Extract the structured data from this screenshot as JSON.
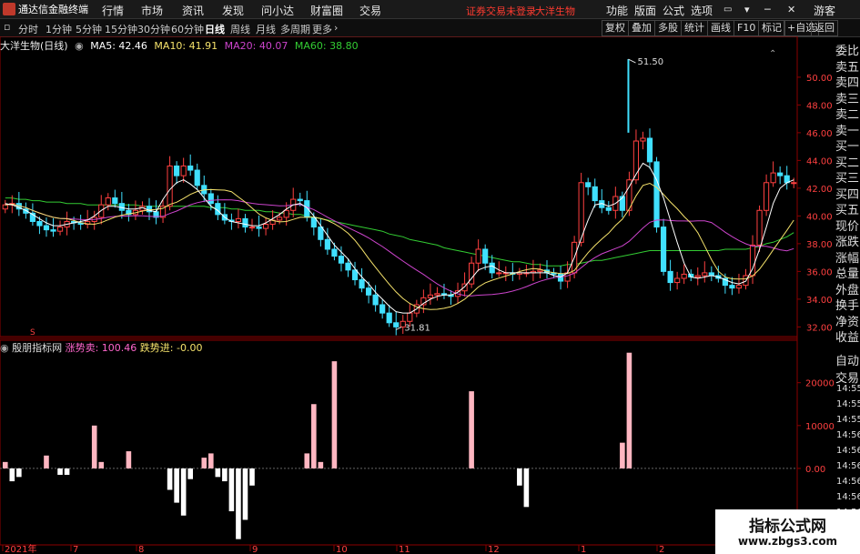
{
  "app": {
    "title": "通达信金融终端",
    "menus": [
      "行情",
      "市场",
      "资讯",
      "发现",
      "问小达",
      "财富圈",
      "交易"
    ],
    "notice": "证券交易未登录",
    "stock_name": "大洋生物",
    "right_menus": [
      "功能",
      "版面",
      "公式",
      "选项"
    ],
    "user": "游客"
  },
  "toolbar": {
    "periods": [
      "分时",
      "1分钟",
      "5分钟",
      "15分钟",
      "30分钟",
      "60分钟",
      "日线",
      "周线",
      "月线",
      "多周期",
      "更多"
    ],
    "active_period": "日线",
    "right_buttons": [
      "复权",
      "叠加",
      "多股",
      "统计",
      "画线",
      "F10",
      "标记",
      "+自选",
      "返回"
    ]
  },
  "main_chart": {
    "title": "大洋生物(日线)",
    "ma": [
      {
        "label": "MA5: 42.46",
        "color": "#ffffff"
      },
      {
        "label": "MA10: 41.91",
        "color": "#f5e26b"
      },
      {
        "label": "MA20: 40.07",
        "color": "#cc44cc"
      },
      {
        "label": "MA60: 38.80",
        "color": "#33cc33"
      }
    ],
    "high_label": "51.50",
    "low_label": "31.81",
    "y_ticks": [
      "50.00",
      "48.00",
      "46.00",
      "44.00",
      "42.00",
      "40.00",
      "38.00",
      "36.00",
      "34.00",
      "32.00"
    ]
  },
  "side_panel": [
    "委比",
    "卖五",
    "卖四",
    "卖三",
    "卖二",
    "卖一",
    "买一",
    "买二",
    "买三",
    "买四",
    "买五",
    "现价",
    "涨跌",
    "涨幅",
    "总量",
    "外盘",
    "换手",
    "净资",
    "收益"
  ],
  "indicator": {
    "name": "殷朋指标网",
    "sell_label": "涨势卖: 100.46",
    "buy_label": "跌势进: -0.00",
    "y_ticks": [
      "20000",
      "10000",
      "0.00"
    ],
    "auto_trade": [
      "自动",
      "交易"
    ]
  },
  "time_list": [
    "14:55",
    "14:55",
    "14:55",
    "14:56",
    "14:56",
    "14:56",
    "14:56",
    "14:56",
    "14:56",
    "14:56",
    "14:56"
  ],
  "x_axis": [
    "2021年",
    "7",
    "8",
    "9",
    "10",
    "11",
    "12",
    "1",
    "2"
  ],
  "watermark": {
    "line1": "指标公式网",
    "line2": "www.zbgs3.com"
  },
  "colors": {
    "up": "#ff4040",
    "down": "#40e0ff",
    "ma5": "#ffffff",
    "ma10": "#f5e26b",
    "ma20": "#cc44cc",
    "ma60": "#33cc33",
    "sell": "#ffb6c1",
    "buy": "#ffffff"
  },
  "chart_data": {
    "type": "candlestick",
    "price_ylim": [
      31.5,
      51.5
    ],
    "indicator_ylim": [
      -17000,
      28000
    ],
    "price_series": [
      40.8,
      40.9,
      40.5,
      40.2,
      39.6,
      39.3,
      39.0,
      38.9,
      39.2,
      39.6,
      39.5,
      39.4,
      39.6,
      39.9,
      40.8,
      41.3,
      40.9,
      40.4,
      40.1,
      40.4,
      40.7,
      40.3,
      39.9,
      40.7,
      43.6,
      42.9,
      43.6,
      43.3,
      42.2,
      41.6,
      40.9,
      40.1,
      39.7,
      39.6,
      39.8,
      39.2,
      39.2,
      39.1,
      39.4,
      39.7,
      39.9,
      40.4,
      41.2,
      41.1,
      39.9,
      39.2,
      38.3,
      37.6,
      37.1,
      36.6,
      36.1,
      35.4,
      34.8,
      34.3,
      33.6,
      33.0,
      32.3,
      32.0,
      32.4,
      33.0,
      33.6,
      34.1,
      34.3,
      34.4,
      34.3,
      34.2,
      34.6,
      35.1,
      36.6,
      37.6,
      36.6,
      35.9,
      35.9,
      35.9,
      35.8,
      35.9,
      35.9,
      36.0,
      36.1,
      35.9,
      35.8,
      35.3,
      35.9,
      38.1,
      42.4,
      42.1,
      41.1,
      40.6,
      40.4,
      41.4,
      40.4,
      42.6,
      45.4,
      45.6,
      43.9,
      39.2,
      36.0,
      35.2,
      35.5,
      35.8,
      35.6,
      35.7,
      35.9,
      35.7,
      35.5,
      35.0,
      34.8,
      35.0,
      35.7,
      37.9,
      40.4,
      42.4,
      43.1,
      42.9,
      42.4,
      42.4
    ],
    "indicator_series": [
      1500,
      -3000,
      -2000,
      0,
      0,
      0,
      3000,
      0,
      -1500,
      -1500,
      0,
      0,
      0,
      10000,
      1500,
      0,
      0,
      0,
      4000,
      0,
      0,
      0,
      0,
      0,
      -5000,
      -8000,
      -11000,
      -2500,
      0,
      2500,
      3500,
      -2000,
      -3000,
      -10000,
      -16500,
      -12000,
      -4000,
      0,
      0,
      0,
      0,
      0,
      0,
      0,
      3500,
      15000,
      1500,
      0,
      25000,
      0,
      0,
      0,
      0,
      0,
      0,
      0,
      0,
      0,
      0,
      0,
      0,
      0,
      0,
      0,
      0,
      0,
      0,
      0,
      18000,
      0,
      0,
      0,
      0,
      0,
      0,
      -4000,
      -9000,
      0,
      0,
      0,
      0,
      0,
      0,
      0,
      0,
      0,
      0,
      0,
      0,
      0,
      6000,
      27000,
      0,
      0,
      0,
      0,
      0,
      0,
      0,
      0,
      0,
      0,
      0,
      0,
      0,
      0,
      0,
      0,
      0,
      0,
      0,
      0,
      0,
      0,
      0,
      0
    ],
    "ma5": [
      40.9,
      40.8,
      40.6,
      40.4,
      40.1,
      39.8,
      39.5,
      39.3,
      39.3,
      39.4,
      39.5,
      39.6,
      39.7,
      40.0,
      40.4,
      40.7,
      40.7,
      40.6,
      40.5,
      40.5,
      40.6,
      40.4,
      40.3,
      41.2,
      41.9,
      42.4,
      42.6,
      42.3,
      41.9,
      41.3,
      40.7,
      40.4,
      39.9,
      39.6,
      39.5,
      39.4,
      39.3,
      39.3,
      39.5,
      39.8,
      40.1,
      40.5,
      40.8,
      40.9,
      40.6,
      40.0,
      39.3,
      38.6,
      37.9,
      37.4,
      36.9,
      36.2,
      35.6,
      35.1,
      34.5,
      34.0,
      33.5,
      33.1,
      33.0,
      33.0,
      33.3,
      33.7,
      34.0,
      34.2,
      34.3,
      34.3,
      34.5,
      34.9,
      35.5,
      36.1,
      36.3,
      36.4,
      36.1,
      35.9,
      35.9,
      35.9,
      35.9,
      35.9,
      35.9,
      35.9,
      35.7,
      35.6,
      35.9,
      37.0,
      38.4,
      39.7,
      40.8,
      40.9,
      40.7,
      40.9,
      41.3,
      42.1,
      43.0,
      43.8,
      43.5,
      42.6,
      41.3,
      39.7,
      38.1,
      36.6,
      35.6,
      35.5,
      35.6,
      35.7,
      35.6,
      35.4,
      35.2,
      35.1,
      35.3,
      36.2,
      37.6,
      39.2,
      40.9,
      42.0,
      42.4,
      42.6
    ],
    "ma60": [
      41.3,
      41.3,
      41.2,
      41.2,
      41.1,
      41.1,
      41.0,
      41.0,
      41.0,
      40.9,
      40.9,
      40.9,
      40.8,
      40.8,
      40.8,
      40.8,
      40.8,
      40.8,
      40.8,
      40.8,
      40.7,
      40.7,
      40.7,
      40.7,
      40.7,
      40.7,
      40.7,
      40.7,
      40.7,
      40.7,
      40.6,
      40.6,
      40.6,
      40.5,
      40.5,
      40.4,
      40.4,
      40.4,
      40.3,
      40.3,
      40.2,
      40.2,
      40.1,
      40.1,
      40.0,
      39.9,
      39.8,
      39.7,
      39.6,
      39.5,
      39.4,
      39.3,
      39.2,
      39.1,
      39.0,
      38.9,
      38.7,
      38.6,
      38.5,
      38.3,
      38.2,
      38.1,
      38.0,
      37.9,
      37.7,
      37.6,
      37.5,
      37.4,
      37.3,
      37.2,
      37.1,
      37.0,
      36.9,
      36.8,
      36.7,
      36.7,
      36.6,
      36.5,
      36.5,
      36.4,
      36.4,
      36.4,
      36.5,
      36.5,
      36.6,
      36.7,
      36.8,
      36.8,
      36.9,
      37.0,
      37.1,
      37.2,
      37.3,
      37.4,
      37.5,
      37.5,
      37.5,
      37.5,
      37.5,
      37.5,
      37.5,
      37.5,
      37.5,
      37.5,
      37.5,
      37.6,
      37.6,
      37.6,
      37.6,
      37.7,
      37.8,
      38.0,
      38.1,
      38.3,
      38.5,
      38.8
    ]
  }
}
